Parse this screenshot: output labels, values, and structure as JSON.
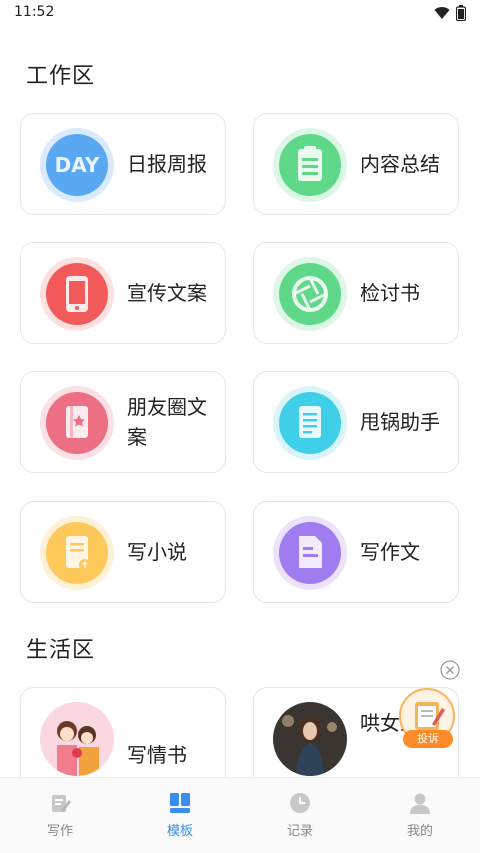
{
  "status": {
    "time": "11:52"
  },
  "sections": {
    "work": "工作区",
    "life": "生活区"
  },
  "cards": {
    "daily": {
      "label": "日报周报",
      "icon_text": "DAY"
    },
    "summary": {
      "label": "内容总结"
    },
    "promo": {
      "label": "宣传文案"
    },
    "review": {
      "label": "检讨书"
    },
    "moments": {
      "label": "朋友圈文案"
    },
    "blame": {
      "label": "甩锅助手"
    },
    "novel": {
      "label": "写小说"
    },
    "essay": {
      "label": "写作文"
    },
    "love_letter": {
      "label": "写情书"
    },
    "coax": {
      "label": "哄女友"
    }
  },
  "float": {
    "report_label": "投诉"
  },
  "tabbar": {
    "items": [
      {
        "label": "写作",
        "icon": "pencil-doc-icon"
      },
      {
        "label": "模板",
        "icon": "grid-icon",
        "active": true
      },
      {
        "label": "记录",
        "icon": "clock-icon"
      },
      {
        "label": "我的",
        "icon": "person-icon"
      }
    ]
  },
  "colors": {
    "accent": "#3a8df0",
    "blue": "#5aa8f2",
    "green": "#5fd989",
    "red": "#f25a5a",
    "pink": "#ec6f83",
    "cyan": "#3fcfe8",
    "yellow": "#ffc85b",
    "purple": "#9f7cf0"
  }
}
